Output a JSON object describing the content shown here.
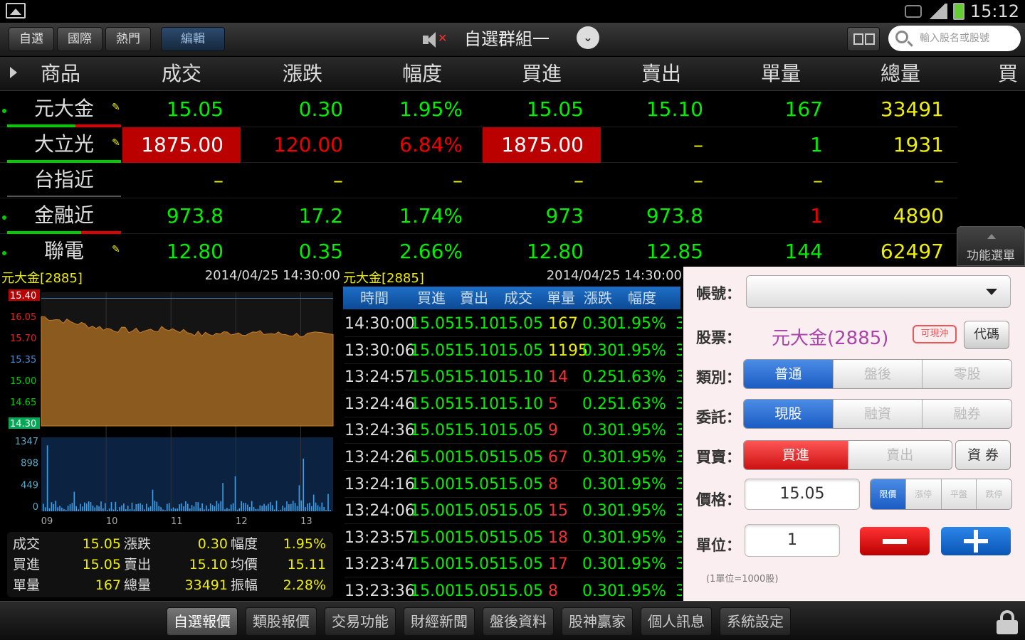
{
  "status_bar": {
    "time": "15:12"
  },
  "toolbar": {
    "tabs": [
      {
        "label": "自選"
      },
      {
        "label": "國際"
      },
      {
        "label": "熱門"
      },
      {
        "label": "編輯"
      }
    ],
    "group_title": "自選群組一",
    "search_placeholder": "輸入股名或股號"
  },
  "quote_table": {
    "columns": [
      "商品",
      "成交",
      "漲跌",
      "幅度",
      "買進",
      "賣出",
      "單量",
      "總量",
      "買"
    ],
    "rows": [
      {
        "name": "元大金",
        "price": "15.05",
        "change": "0.30",
        "pct": "1.95%",
        "bid": "15.05",
        "ask": "15.10",
        "vol": "167",
        "total": "33491"
      },
      {
        "name": "大立光",
        "price": "1875.00",
        "change": "120.00",
        "pct": "6.84%",
        "bid": "1875.00",
        "ask": "–",
        "vol": "1",
        "total": "1931"
      },
      {
        "name": "台指近",
        "price": "–",
        "change": "–",
        "pct": "–",
        "bid": "–",
        "ask": "–",
        "vol": "–",
        "total": "–"
      },
      {
        "name": "金融近",
        "price": "973.8",
        "change": "17.2",
        "pct": "1.74%",
        "bid": "973",
        "ask": "973.8",
        "vol": "1",
        "total": "4890"
      },
      {
        "name": "聯電",
        "price": "12.80",
        "change": "0.35",
        "pct": "2.66%",
        "bid": "12.80",
        "ask": "12.85",
        "vol": "144",
        "total": "62497"
      }
    ],
    "function_menu_label": "功能選單"
  },
  "chart": {
    "ticker": "元大金[2885]",
    "datetime": "2014/04/25 14:30:00",
    "price_ticks": [
      "15.40",
      "16.05",
      "15.70",
      "15.35",
      "15.00",
      "14.65",
      "14.30"
    ],
    "volume_ticks": [
      "1347",
      "898",
      "449",
      "0"
    ],
    "time_ticks": [
      "09",
      "10",
      "11",
      "12",
      "13"
    ],
    "summary": [
      [
        "成交",
        "15.05",
        "漲跌",
        "0.30",
        "幅度",
        "1.95%"
      ],
      [
        "買進",
        "15.05",
        "賣出",
        "15.10",
        "均價",
        "15.11"
      ],
      [
        "單量",
        "167",
        "總量",
        "33491",
        "振幅",
        "2.28%"
      ]
    ]
  },
  "chart_data": {
    "type": "line",
    "x_range": [
      "09:00",
      "13:30"
    ],
    "price_series": {
      "name": "成交",
      "reference": 15.35,
      "approx_level": [
        15.2,
        15.15,
        15.1,
        15.08,
        15.1,
        15.05,
        15.07,
        15.06,
        15.05,
        15.05
      ],
      "ylim": [
        14.3,
        15.4
      ]
    },
    "volume_series": {
      "name": "單量",
      "ylim": [
        0,
        1347
      ]
    }
  },
  "ticks": {
    "ticker": "元大金[2885]",
    "datetime": "2014/04/25 14:30:00",
    "columns": [
      "時間",
      "買進",
      "賣出",
      "成交",
      "單量",
      "漲跌",
      "幅度"
    ],
    "rows": [
      [
        "14:30:00",
        "15.05",
        "15.10",
        "15.05",
        "167",
        "0.30",
        "1.95%"
      ],
      [
        "13:30:06",
        "15.05",
        "15.10",
        "15.05",
        "1195",
        "0.30",
        "1.95%"
      ],
      [
        "13:24:57",
        "15.05",
        "15.10",
        "15.10",
        "14",
        "0.25",
        "1.63%"
      ],
      [
        "13:24:46",
        "15.05",
        "15.10",
        "15.10",
        "5",
        "0.25",
        "1.63%"
      ],
      [
        "13:24:36",
        "15.05",
        "15.10",
        "15.05",
        "9",
        "0.30",
        "1.95%"
      ],
      [
        "13:24:26",
        "15.00",
        "15.05",
        "15.05",
        "67",
        "0.30",
        "1.95%"
      ],
      [
        "13:24:16",
        "15.00",
        "15.05",
        "15.05",
        "8",
        "0.30",
        "1.95%"
      ],
      [
        "13:24:06",
        "15.00",
        "15.05",
        "15.05",
        "15",
        "0.30",
        "1.95%"
      ],
      [
        "13:23:57",
        "15.00",
        "15.05",
        "15.05",
        "18",
        "0.30",
        "1.95%"
      ],
      [
        "13:23:47",
        "15.00",
        "15.05",
        "15.05",
        "17",
        "0.30",
        "1.95%"
      ],
      [
        "13:23:36",
        "15.00",
        "15.05",
        "15.05",
        "8",
        "0.30",
        "1.95%"
      ]
    ]
  },
  "order": {
    "account_label": "帳號：",
    "stock_label": "股票：",
    "stock_value": "元大金(2885)",
    "badge": "可現沖",
    "code_btn": "代碼",
    "type_label": "類別：",
    "type_options": [
      "普通",
      "盤後",
      "零股"
    ],
    "entrust_label": "委託：",
    "entrust_options": [
      "現股",
      "融資",
      "融券"
    ],
    "side_label": "買賣：",
    "side_options": [
      "買進",
      "賣出"
    ],
    "asset_btn": "資 券",
    "price_label": "價格：",
    "price_value": "15.05",
    "price_options": [
      "限價",
      "漲停",
      "平盤",
      "跌停"
    ],
    "unit_label": "單位：",
    "unit_value": "1",
    "unit_note": "(1單位=1000股)"
  },
  "bottom_nav": [
    "自選報價",
    "類股報價",
    "交易功能",
    "財經新聞",
    "盤後資料",
    "股神贏家",
    "個人訊息",
    "系統設定"
  ]
}
